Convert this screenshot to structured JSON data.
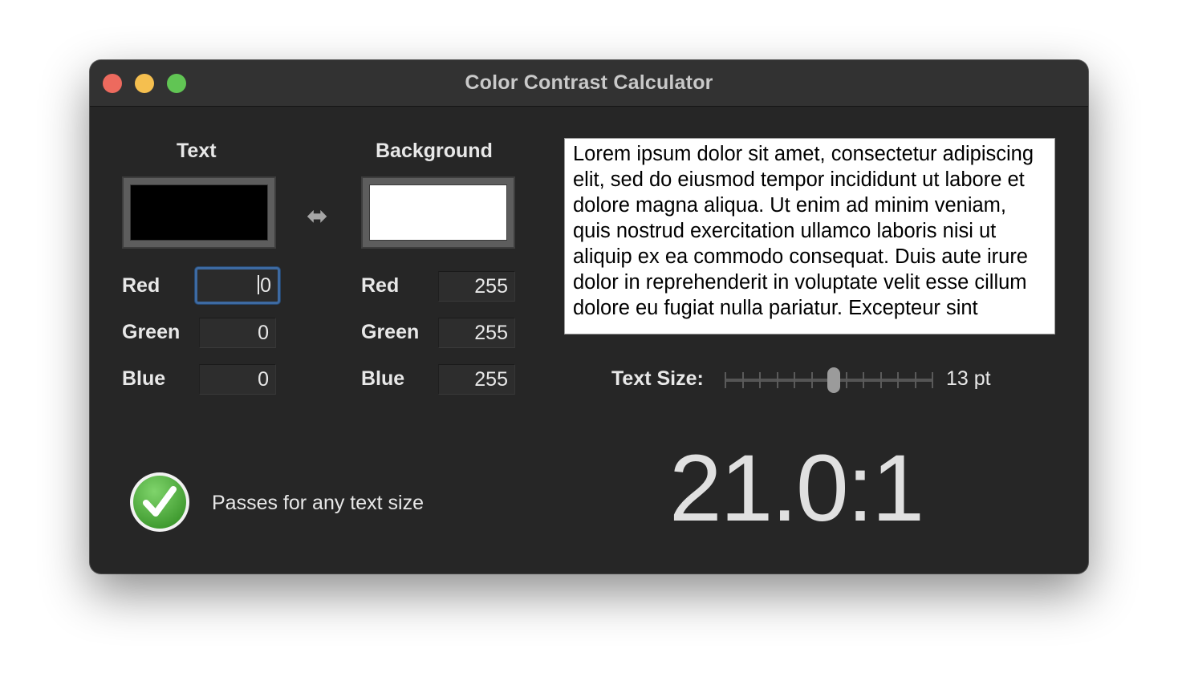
{
  "window": {
    "title": "Color Contrast Calculator"
  },
  "text_color": {
    "heading": "Text",
    "swatch_color": "#000000",
    "red_label": "Red",
    "red_value": "0",
    "green_label": "Green",
    "green_value": "0",
    "blue_label": "Blue",
    "blue_value": "0"
  },
  "background_color": {
    "heading": "Background",
    "swatch_color": "#ffffff",
    "red_label": "Red",
    "red_value": "255",
    "green_label": "Green",
    "green_value": "255",
    "blue_label": "Blue",
    "blue_value": "255"
  },
  "swap_icon": "left-right-arrow-icon",
  "preview": {
    "text": "Lorem ipsum dolor sit amet, consectetur adipiscing elit, sed do eiusmod tempor incididunt ut labore et dolore magna aliqua. Ut enim ad minim veniam, quis nostrud exercitation ullamco laboris nisi ut aliquip ex ea commodo consequat. Duis aute irure dolor in reprehenderit in voluptate velit esse cillum dolore eu fugiat nulla pariatur. Excepteur sint"
  },
  "text_size": {
    "label": "Text Size:",
    "value": "13 pt"
  },
  "result": {
    "status_icon": "checkmark-icon",
    "status_color": "#4cae3c",
    "status_text": "Passes for any text size",
    "ratio": "21.0:1"
  }
}
